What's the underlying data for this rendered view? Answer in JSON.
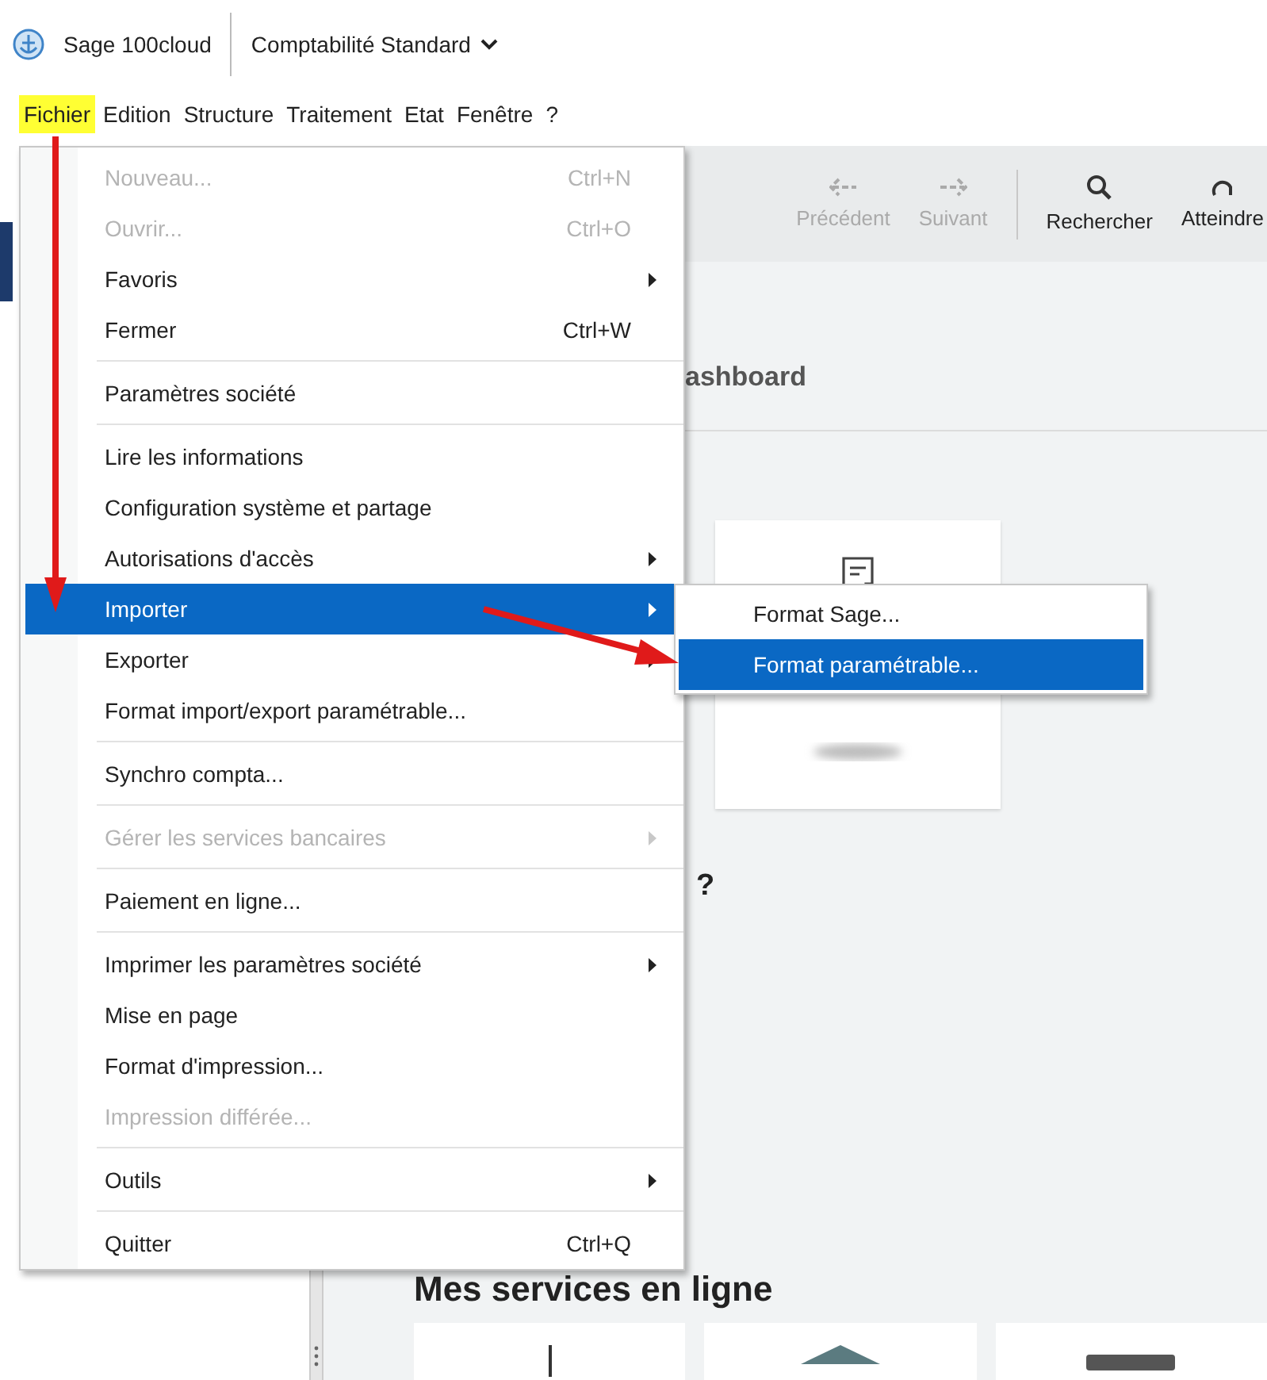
{
  "header": {
    "app_name": "Sage 100cloud",
    "product": "Comptabilité Standard"
  },
  "menubar": [
    {
      "label": "Fichier",
      "selected": true
    },
    {
      "label": "Edition",
      "selected": false
    },
    {
      "label": "Structure",
      "selected": false
    },
    {
      "label": "Traitement",
      "selected": false
    },
    {
      "label": "Etat",
      "selected": false
    },
    {
      "label": "Fenêtre",
      "selected": false
    },
    {
      "label": "?",
      "selected": false
    }
  ],
  "toolbar": [
    {
      "kind": "back",
      "label": "Précédent",
      "disabled": true
    },
    {
      "kind": "forward",
      "label": "Suivant",
      "disabled": true
    },
    {
      "kind": "separator"
    },
    {
      "kind": "search",
      "label": "Rechercher",
      "disabled": false
    },
    {
      "kind": "goto",
      "label": "Atteindre",
      "disabled": false
    }
  ],
  "content": {
    "title": "ashboard",
    "question_heading": "?",
    "services_heading": "Mes services en ligne"
  },
  "file_menu": {
    "sections": [
      [
        {
          "label": "Nouveau...",
          "shortcut": "Ctrl+N",
          "disabled": true,
          "selected": false,
          "submenu": false
        },
        {
          "label": "Ouvrir...",
          "shortcut": "Ctrl+O",
          "disabled": true,
          "selected": false,
          "submenu": false
        },
        {
          "label": "Favoris",
          "disabled": false,
          "selected": false,
          "submenu": true
        },
        {
          "label": "Fermer",
          "shortcut": "Ctrl+W",
          "disabled": false,
          "selected": false,
          "submenu": false
        }
      ],
      [
        {
          "label": "Paramètres société",
          "disabled": false,
          "selected": false,
          "submenu": false
        }
      ],
      [
        {
          "label": "Lire les informations",
          "disabled": false,
          "selected": false,
          "submenu": false
        },
        {
          "label": "Configuration système et partage",
          "disabled": false,
          "selected": false,
          "submenu": false
        },
        {
          "label": "Autorisations d'accès",
          "disabled": false,
          "selected": false,
          "submenu": true
        },
        {
          "label": "Importer",
          "disabled": false,
          "selected": true,
          "submenu": true
        },
        {
          "label": "Exporter",
          "disabled": false,
          "selected": false,
          "submenu": true
        },
        {
          "label": "Format import/export paramétrable...",
          "disabled": false,
          "selected": false,
          "submenu": false
        }
      ],
      [
        {
          "label": "Synchro compta...",
          "disabled": false,
          "selected": false,
          "submenu": false
        }
      ],
      [
        {
          "label": "Gérer les services bancaires",
          "disabled": true,
          "selected": false,
          "submenu": true
        }
      ],
      [
        {
          "label": "Paiement en ligne...",
          "disabled": false,
          "selected": false,
          "submenu": false
        }
      ],
      [
        {
          "label": "Imprimer les paramètres société",
          "disabled": false,
          "selected": false,
          "submenu": true
        },
        {
          "label": "Mise en page",
          "disabled": false,
          "selected": false,
          "submenu": false
        },
        {
          "label": "Format d'impression...",
          "disabled": false,
          "selected": false,
          "submenu": false
        },
        {
          "label": "Impression différée...",
          "disabled": true,
          "selected": false,
          "submenu": false
        }
      ],
      [
        {
          "label": "Outils",
          "disabled": false,
          "selected": false,
          "submenu": true
        }
      ],
      [
        {
          "label": "Quitter",
          "shortcut": "Ctrl+Q",
          "disabled": false,
          "selected": false,
          "submenu": false
        }
      ]
    ]
  },
  "import_submenu": [
    {
      "label": "Format Sage...",
      "selected": false
    },
    {
      "label": "Format paramétrable...",
      "selected": true
    }
  ]
}
